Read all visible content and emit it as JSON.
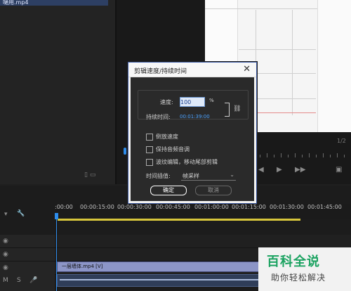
{
  "project_panel": {
    "clip_name_fragment": "嗵用.mp4",
    "bottom_icons": [
      "▯",
      "▭"
    ]
  },
  "program_monitor": {
    "label": "1/2",
    "controls": [
      "◀",
      "▶",
      "▶▶",
      "▣"
    ]
  },
  "timeline": {
    "timecodes": [
      ":00:00",
      "00:00:15:00",
      "00:00:30:00",
      "00:00:45:00",
      "00:01:00:00",
      "00:01:15:00",
      "00:01:30:00",
      "00:01:45:00"
    ],
    "video_clip_label": "一层墙体.mp4 [V]",
    "track_tool_icons": [
      "▾",
      "🔧"
    ],
    "a1_icons": [
      "M",
      "S",
      "🎤"
    ]
  },
  "dialog": {
    "title": "剪辑速度/持续时间",
    "speed_label": "速度:",
    "speed_value": "100",
    "percent": "%",
    "duration_label": "持续时间:",
    "duration_value": "00:01:39:00",
    "reverse_label": "倒放速度",
    "maintain_audio_label": "保持音频音调",
    "ripple_label": "波纹编辑，移动尾部剪辑",
    "interpolation_label": "时间插值:",
    "interpolation_value": "帧采样",
    "ok_label": "确定",
    "cancel_label": "取消"
  },
  "watermark": {
    "top": "百科全说",
    "bottom": "助你轻松解决"
  }
}
